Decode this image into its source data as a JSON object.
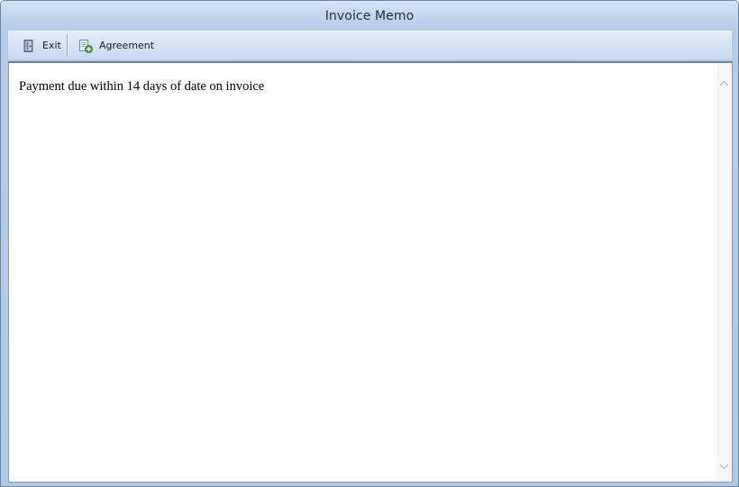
{
  "window": {
    "title": "Invoice Memo"
  },
  "toolbar": {
    "exit_label": "Exit",
    "agreement_label": "Agreement"
  },
  "memo": {
    "text": "Payment due within 14 days of date on invoice"
  },
  "icons": {
    "exit": "exit-door-icon",
    "agreement": "agreement-add-icon",
    "scroll_up": "chevron-up-icon",
    "scroll_down": "chevron-down-icon"
  },
  "colors": {
    "frame": "#b6cde8",
    "toolbar": "#d6e3f4",
    "editor_bg": "#ffffff"
  }
}
